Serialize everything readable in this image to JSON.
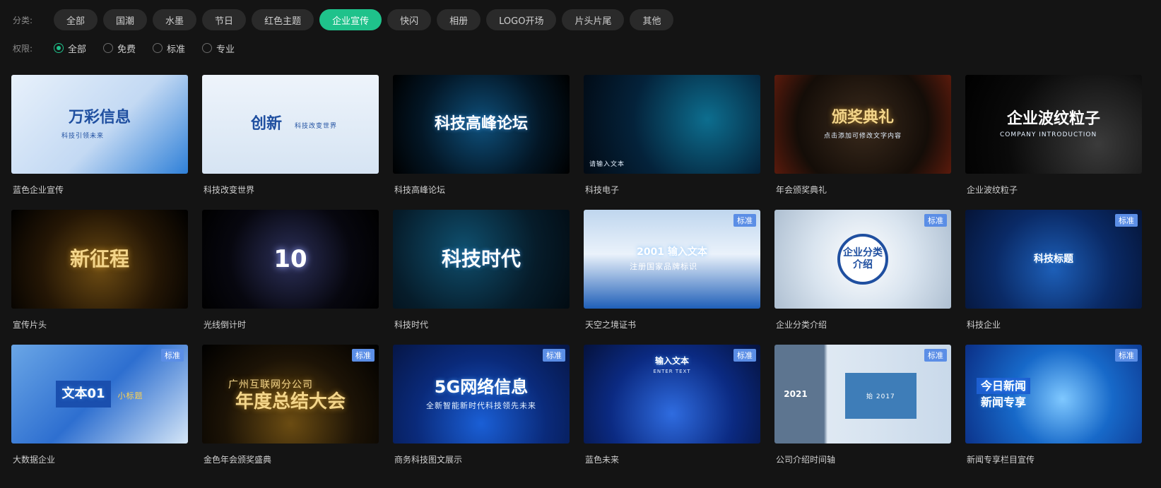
{
  "filters": {
    "category_label": "分类:",
    "categories": [
      "全部",
      "国潮",
      "水墨",
      "节日",
      "红色主题",
      "企业宣传",
      "快闪",
      "相册",
      "LOGO开场",
      "片头片尾",
      "其他"
    ],
    "active_category_index": 5,
    "permission_label": "权限:",
    "permissions": [
      "全部",
      "免费",
      "标准",
      "专业"
    ],
    "active_permission_index": 0
  },
  "colors": {
    "accent": "#1fc28b",
    "badge": "#5b8ee6",
    "background": "#141414"
  },
  "badge_text": "标准",
  "templates": [
    {
      "name": "蓝色企业宣传",
      "thumb_title": "万彩信息",
      "thumb_sub": "科技引领未来",
      "badge": false
    },
    {
      "name": "科技改变世界",
      "thumb_title": "创新",
      "thumb_sub": "科技改变世界",
      "badge": false
    },
    {
      "name": "科技高峰论坛",
      "thumb_title": "科技高峰论坛",
      "thumb_sub": "",
      "badge": false
    },
    {
      "name": "科技电子",
      "thumb_title": "",
      "thumb_sub": "请输入文本",
      "badge": false
    },
    {
      "name": "年会颁奖典礼",
      "thumb_title": "颁奖典礼",
      "thumb_sub": "点击添加可修改文字内容",
      "badge": false
    },
    {
      "name": "企业波纹粒子",
      "thumb_title": "企业波纹粒子",
      "thumb_sub": "COMPANY INTRODUCTION",
      "badge": false
    },
    {
      "name": "宣传片头",
      "thumb_title": "新征程",
      "thumb_sub": "",
      "badge": false
    },
    {
      "name": "光线倒计时",
      "thumb_title": "10",
      "thumb_sub": "",
      "badge": false
    },
    {
      "name": "科技时代",
      "thumb_title": "科技时代",
      "thumb_sub": "",
      "badge": false
    },
    {
      "name": "天空之境证书",
      "thumb_title": "2001 输入文本",
      "thumb_sub": "注册国家品牌标识",
      "badge": true
    },
    {
      "name": "企业分类介绍",
      "thumb_title": "企业分类介绍",
      "thumb_sub": "",
      "badge": true
    },
    {
      "name": "科技企业",
      "thumb_title": "科技标题",
      "thumb_sub": "",
      "badge": true
    },
    {
      "name": "大数据企业",
      "thumb_title": "文本01",
      "thumb_sub": "小标题",
      "badge": true
    },
    {
      "name": "金色年会颁奖盛典",
      "thumb_title": "年度总结大会",
      "thumb_sub": "广州互联网分公司",
      "badge": true
    },
    {
      "name": "商务科技图文展示",
      "thumb_title": "5G网络信息",
      "thumb_sub": "全新智能新时代科技领先未来",
      "badge": true
    },
    {
      "name": "蓝色未来",
      "thumb_title": "输入文本",
      "thumb_sub": "ENTER TEXT",
      "badge": true
    },
    {
      "name": "公司介绍时间轴",
      "thumb_title": "2021",
      "thumb_sub": "始 2017",
      "badge": true
    },
    {
      "name": "新闻专享栏目宣传",
      "thumb_title": "今日新闻",
      "thumb_sub": "新闻专享",
      "badge": true
    }
  ]
}
